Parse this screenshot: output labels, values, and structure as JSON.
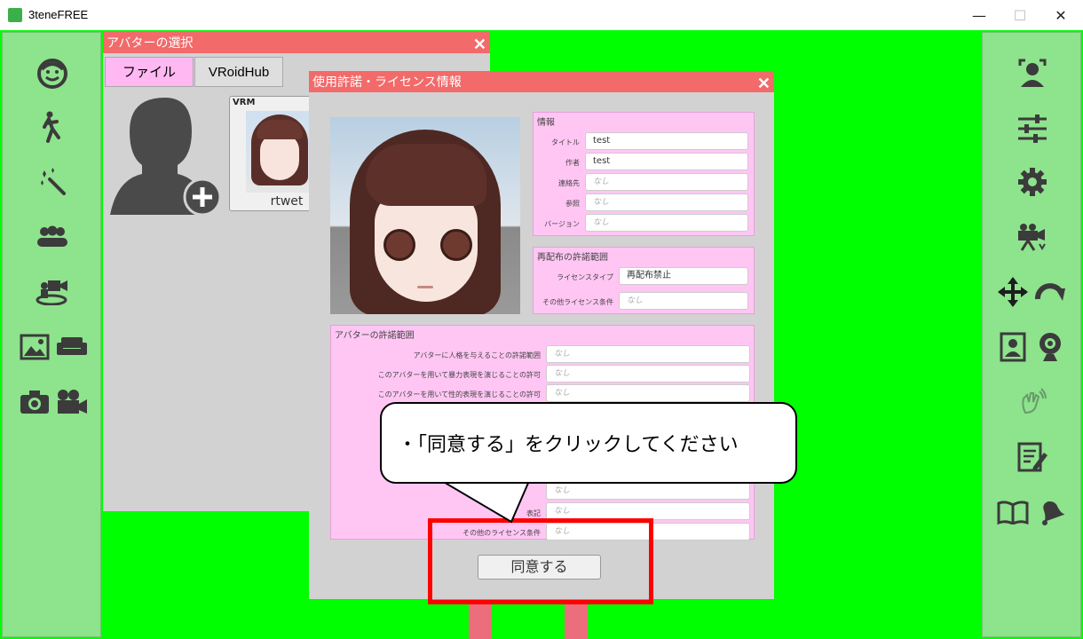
{
  "window": {
    "title": "3teneFREE",
    "minimize": "—",
    "maximize": "☐",
    "close": "✕"
  },
  "left_sidebar": {
    "icons": [
      "face-icon",
      "pose-icon",
      "magic-wand-icon",
      "group-icon",
      "camera-stage-icon",
      "background-image-icon",
      "sofa-icon",
      "photo-camera-icon",
      "video-camera-icon"
    ]
  },
  "right_sidebar": {
    "icons": [
      "face-tracking-icon",
      "sliders-icon",
      "settings-gear-icon",
      "camera-motion-icon",
      "move-arrows-icon",
      "rotate-icon",
      "portrait-icon",
      "webcam-icon",
      "hand-wave-icon",
      "edit-note-icon",
      "manual-book-icon",
      "bell-icon"
    ]
  },
  "avatar_select": {
    "title": "アバターの選択",
    "tabs": [
      "ファイル",
      "VRoidHub"
    ],
    "vrm_badge": "VRM",
    "model_name": "rtwet"
  },
  "license_dialog": {
    "title": "使用許諾・ライセンス情報",
    "info": {
      "title": "情報",
      "rows": [
        {
          "label": "タイトル",
          "value": "test",
          "empty": false
        },
        {
          "label": "作者",
          "value": "test",
          "empty": false
        },
        {
          "label": "連絡先",
          "value": "なし",
          "empty": true
        },
        {
          "label": "参照",
          "value": "なし",
          "empty": true
        },
        {
          "label": "バージョン",
          "value": "なし",
          "empty": true
        }
      ]
    },
    "redistribution": {
      "title": "再配布の許諾範囲",
      "rows": [
        {
          "label": "ライセンスタイプ",
          "value": "再配布禁止",
          "empty": false
        },
        {
          "label": "その他ライセンス条件",
          "value": "なし",
          "empty": true
        }
      ]
    },
    "avatar_permissions": {
      "title": "アバターの許諾範囲",
      "rows": [
        {
          "label": "アバターに人格を与えることの許諾範囲",
          "value": "なし"
        },
        {
          "label": "このアバターを用いて暴力表現を演じることの許可",
          "value": "なし"
        },
        {
          "label": "このアバターを用いて性的表現を演じることの許可",
          "value": "なし"
        }
      ],
      "lower_rows": [
        {
          "label": "",
          "value": "なし"
        },
        {
          "label": "表記",
          "value": "なし"
        },
        {
          "label": "その他のライセンス条件",
          "value": "なし"
        }
      ]
    },
    "agree_label": "同意する"
  },
  "tooltip": {
    "text": "・「同意する」をクリックしてください"
  }
}
